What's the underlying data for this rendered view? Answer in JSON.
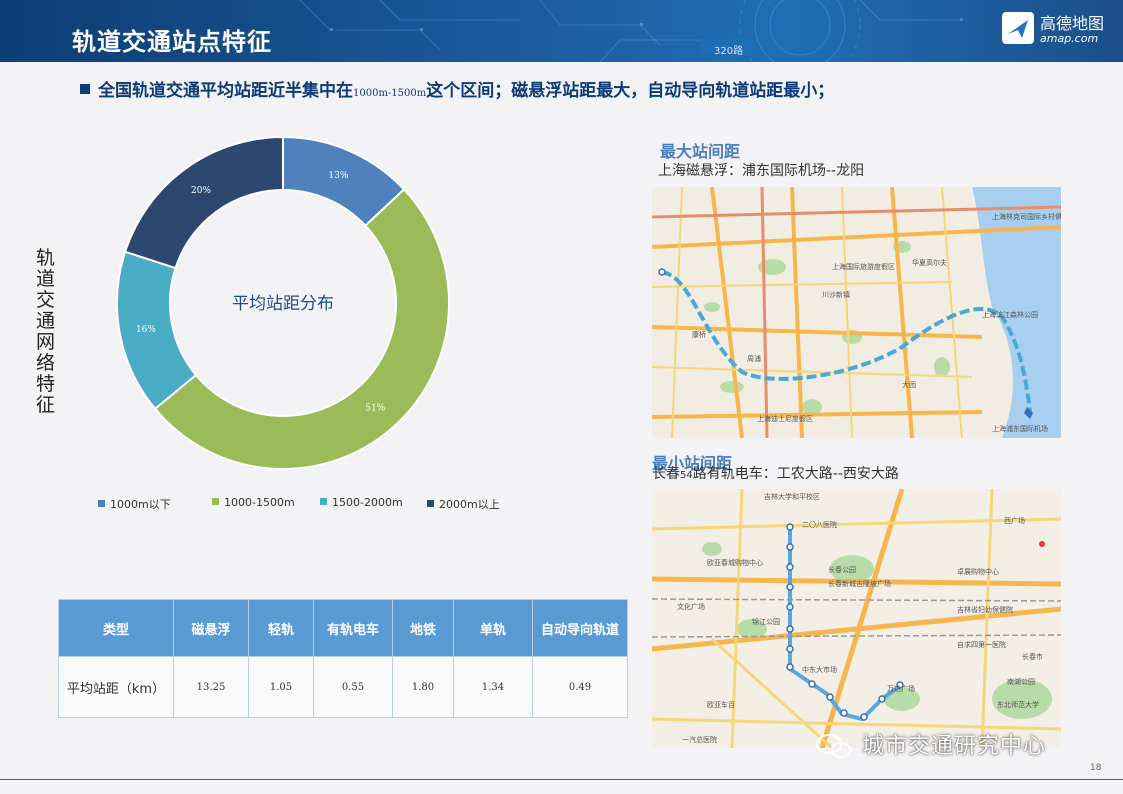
{
  "header": {
    "title": "轨道交通站点特征",
    "road_tag": "320路",
    "logo_name": "高德地图",
    "logo_sub": "amap.com"
  },
  "subtitle": {
    "part1": "全国轨道交通平均站距近半集中在",
    "range": "1000m-1500m",
    "part2": "这个区间；磁悬浮站距最大，自动导向轨道站距最小；"
  },
  "side_label": "轨道交通网络特征",
  "chart_data": {
    "type": "pie",
    "title": "平均站距分布",
    "categories": [
      "1000m以下",
      "1000-1500m",
      "1500-2000m",
      "2000m以上"
    ],
    "values": [
      13,
      51,
      16,
      20
    ],
    "value_labels": [
      "13%",
      "51%",
      "16%",
      "20%"
    ],
    "colors": [
      "#4f81bd",
      "#9bbb59",
      "#4bacc6",
      "#2c4770"
    ],
    "legend_position": "bottom",
    "donut": true
  },
  "table": {
    "headers": [
      "类型",
      "磁悬浮",
      "轻轨",
      "有轨电车",
      "地铁",
      "单轨",
      "自动导向轨道"
    ],
    "row_label": "平均站距（km）",
    "values": [
      "13.25",
      "1.05",
      "0.55",
      "1.80",
      "1.34",
      "0.49"
    ]
  },
  "map1": {
    "heading": "最大站间距",
    "caption": "上海磁悬浮：浦东国际机场--龙阳",
    "labels": [
      "上海国际旅游度假区",
      "上海林克司国际乡村俱乐部",
      "华夏高尔夫",
      "川沙新镇",
      "上海滨江森林公园",
      "上海浦东国际机场",
      "上海迪士尼度假区",
      "周浦",
      "康桥",
      "大团"
    ]
  },
  "map2": {
    "heading": "最小站间距",
    "caption_part1": "长春",
    "caption_num": "54",
    "caption_part2": "路有轨电车：工农大路--西安大路",
    "labels": [
      "吉林大学和平校区",
      "二〇八医院",
      "欧亚春城购物中心",
      "长春公园",
      "长春新城吉隆坡广场",
      "卓展购物中心",
      "西广场",
      "吉林省妇幼保健院",
      "自求四第一医院",
      "长春市",
      "欧亚车百",
      "万达广场",
      "一汽总医院",
      "东北师范大学",
      "南湖公园",
      "文化广场",
      "锦江公园",
      "中东大市场"
    ]
  },
  "watermark": "城市交通研究中心",
  "page_number": "18"
}
